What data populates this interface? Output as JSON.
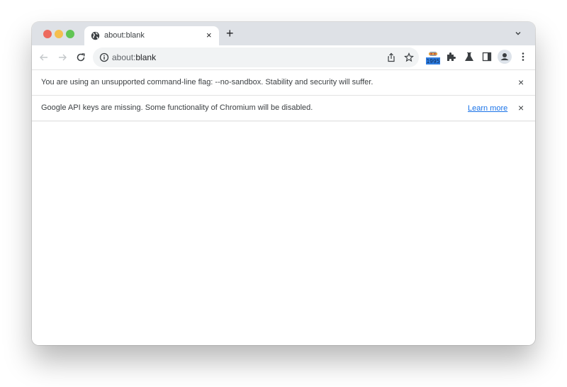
{
  "window": {
    "tabs": [
      {
        "title": "about:blank",
        "icon": "globe-icon",
        "active": true
      }
    ],
    "new_tab_label": "+",
    "tab_close_label": "×"
  },
  "toolbar": {
    "back_icon": "arrow-left-icon",
    "forward_icon": "arrow-right-icon",
    "reload_icon": "reload-icon",
    "omnibox": {
      "scheme": "about:",
      "host": "blank",
      "info_icon": "info-icon"
    },
    "extension_badge": "1995",
    "icons": [
      "share-icon",
      "bookmark-star-icon",
      "extension-robot-icon",
      "puzzle-icon",
      "lab-flask-icon",
      "side-panel-icon",
      "profile-icon",
      "menu-kebab-icon"
    ]
  },
  "infobars": [
    {
      "message": "You are using an unsupported command-line flag: --no-sandbox. Stability and security will suffer.",
      "close": "×"
    },
    {
      "message": "Google API keys are missing. Some functionality of Chromium will be disabled.",
      "link": "Learn more",
      "close": "×"
    }
  ],
  "colors": {
    "tabstrip": "#dee1e6",
    "link": "#1a73e8",
    "close_light": "#ed6a5e",
    "min_light": "#f5bf4f",
    "max_light": "#61c554"
  }
}
